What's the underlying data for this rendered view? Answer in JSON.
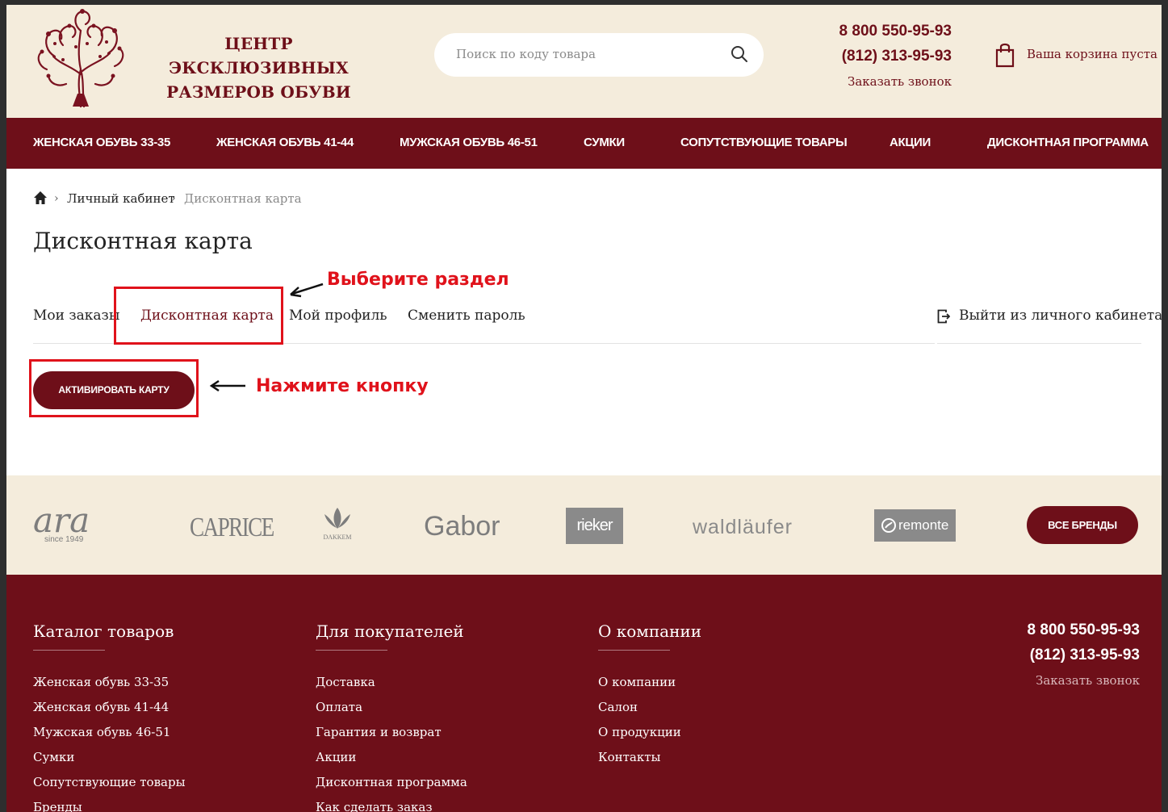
{
  "header": {
    "logo_line1": "ЦЕНТР ЭКСКЛЮЗИВНЫХ",
    "logo_line2": "РАЗМЕРОВ ОБУВИ",
    "search_placeholder": "Поиск по коду товара",
    "phone1": "8 800 550-95-93",
    "phone2": "(812) 313-95-93",
    "callback": "Заказать звонок",
    "cart": "Ваша корзина пуста"
  },
  "nav": {
    "items": [
      "ЖЕНСКАЯ ОБУВЬ 33-35",
      "ЖЕНСКАЯ ОБУВЬ 41-44",
      "МУЖСКАЯ ОБУВЬ 46-51",
      "СУМКИ",
      "СОПУТСТВУЮЩИЕ ТОВАРЫ",
      "АКЦИИ",
      "ДИСКОНТНАЯ ПРОГРАММА"
    ]
  },
  "breadcrumb": {
    "link": "Личный кабинет",
    "current": "Дисконтная карта"
  },
  "page_title": "Дисконтная карта",
  "tabs": {
    "items": [
      "Мои заказы",
      "Дисконтная карта",
      "Мой профиль",
      "Сменить пароль"
    ],
    "active": "Дисконтная карта",
    "logout": "Выйти из личного кабинета"
  },
  "activate_button": "АКТИВИРОВАТЬ КАРТУ",
  "annotations": {
    "select_section": "Выберите раздел",
    "press_button": "Нажмите кнопку",
    "color": "#e0121b"
  },
  "brands": {
    "items": [
      "ara",
      "since 1949",
      "CAPRICE",
      "DAKKEM",
      "Gabor",
      "rieker",
      "waldläufer",
      "remonte"
    ],
    "all_brands_button": "ВСЕ БРЕНДЫ"
  },
  "footer": {
    "catalog": {
      "title": "Каталог товаров",
      "links": [
        "Женская обувь 33-35",
        "Женская обувь 41-44",
        "Мужская обувь 46-51",
        "Сумки",
        "Сопутствующие товары",
        "Бренды"
      ]
    },
    "buyers": {
      "title": "Для покупателей",
      "links": [
        "Доставка",
        "Оплата",
        "Гарантия и возврат",
        "Акции",
        "Дисконтная программа",
        "Как сделать заказ"
      ]
    },
    "company": {
      "title": "О компании",
      "links": [
        "О компании",
        "Салон",
        "О продукции",
        "Контакты"
      ]
    },
    "phone1": "8 800 550-95-93",
    "phone2": "(812) 313-95-93",
    "callback": "Заказать звонок"
  },
  "colors": {
    "brand": "#6e0f19",
    "cream": "#f4ecdc",
    "annotation": "#e0121b"
  }
}
